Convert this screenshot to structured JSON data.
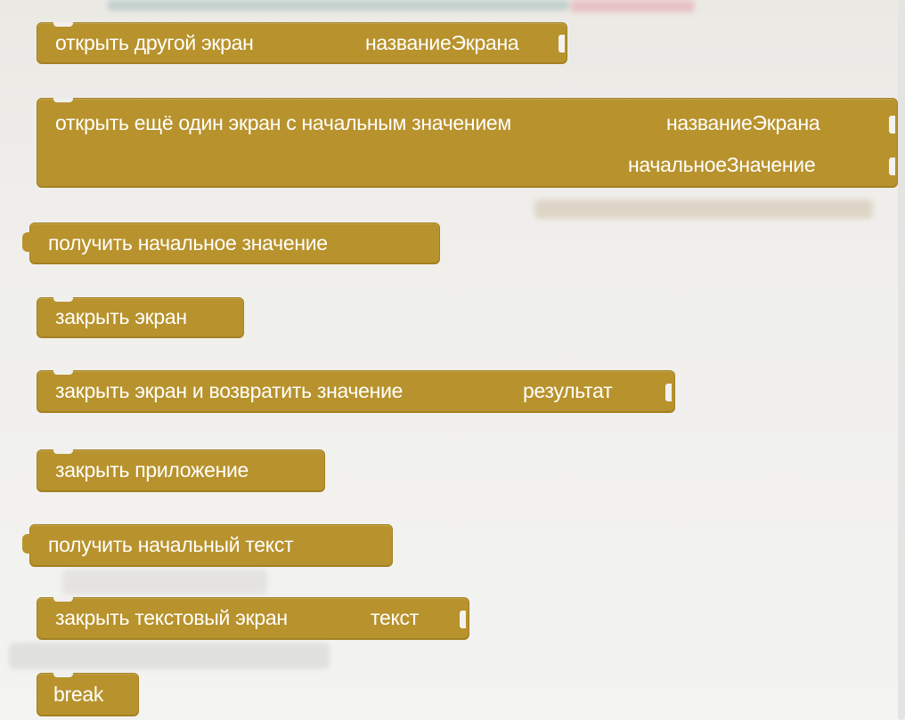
{
  "blocks": {
    "open_screen": {
      "text": "открыть другой экран",
      "param": "названиеЭкрана"
    },
    "open_screen_with_value": {
      "text": "открыть ещё один экран с начальным значением",
      "param1": "названиеЭкрана",
      "param2": "начальноеЗначение"
    },
    "get_start_value": {
      "text": "получить начальное значение"
    },
    "close_screen": {
      "text": "закрыть экран"
    },
    "close_screen_with_value": {
      "text": "закрыть экран и возвратить значение",
      "param": "результат"
    },
    "close_application": {
      "text": "закрыть приложение"
    },
    "get_plain_start_text": {
      "text": "получить начальный текст"
    },
    "close_screen_with_plain_text": {
      "text": "закрыть текстовый экран",
      "param": "текст"
    },
    "break": {
      "text": "break"
    }
  },
  "colors": {
    "block_fill": "#b8922c",
    "block_border": "#a3801f",
    "workspace_bg": "#f1f0ed",
    "block_text": "#ffffff"
  }
}
